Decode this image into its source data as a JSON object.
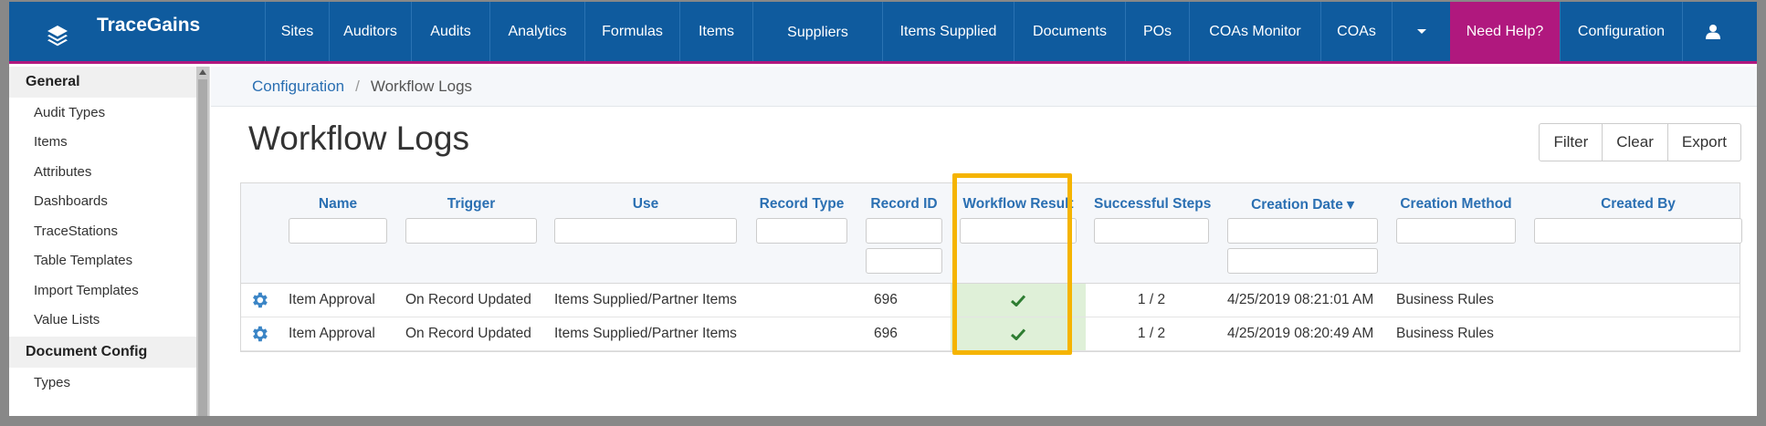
{
  "brand": {
    "name": "TraceGains"
  },
  "nav": {
    "items": [
      "Sites",
      "Auditors",
      "Audits",
      "Analytics",
      "Formulas",
      "Items",
      "Suppliers",
      "Items Supplied",
      "Documents",
      "POs",
      "COAs Monitor",
      "COAs"
    ],
    "help": "Need Help?",
    "config": "Configuration"
  },
  "colors": {
    "nav_bg": "#0f5b9e",
    "help_bg": "#b0187e",
    "highlight": "#f5b400",
    "success_bg": "#dff0d8",
    "success_icon": "#2e7d32"
  },
  "sidebar": {
    "sections": [
      {
        "title": "General",
        "items": [
          "Audit Types",
          "Items",
          "Attributes",
          "Dashboards",
          "TraceStations",
          "Table Templates",
          "Import Templates",
          "Value Lists"
        ]
      },
      {
        "title": "Document Config",
        "items": [
          "Types"
        ]
      }
    ]
  },
  "breadcrumb": {
    "parent": "Configuration",
    "separator": "/",
    "current": "Workflow Logs"
  },
  "page": {
    "title": "Workflow Logs"
  },
  "actions": {
    "filter": "Filter",
    "clear": "Clear",
    "export": "Export"
  },
  "table": {
    "columns": [
      "Name",
      "Trigger",
      "Use",
      "Record Type",
      "Record ID",
      "Workflow Result",
      "Successful Steps",
      "Creation Date ▾",
      "Creation Method",
      "Created By"
    ],
    "rows": [
      {
        "name": "Item Approval",
        "trigger": "On Record Updated",
        "use": "Items Supplied/Partner Items",
        "record_type": "",
        "record_id": "696",
        "result_icon": "check-icon",
        "steps": "1 / 2",
        "created": "4/25/2019 08:21:01 AM",
        "method": "Business Rules",
        "created_by": ""
      },
      {
        "name": "Item Approval",
        "trigger": "On Record Updated",
        "use": "Items Supplied/Partner Items",
        "record_type": "",
        "record_id": "696",
        "result_icon": "check-icon",
        "steps": "1 / 2",
        "created": "4/25/2019 08:20:49 AM",
        "method": "Business Rules",
        "created_by": ""
      }
    ]
  }
}
